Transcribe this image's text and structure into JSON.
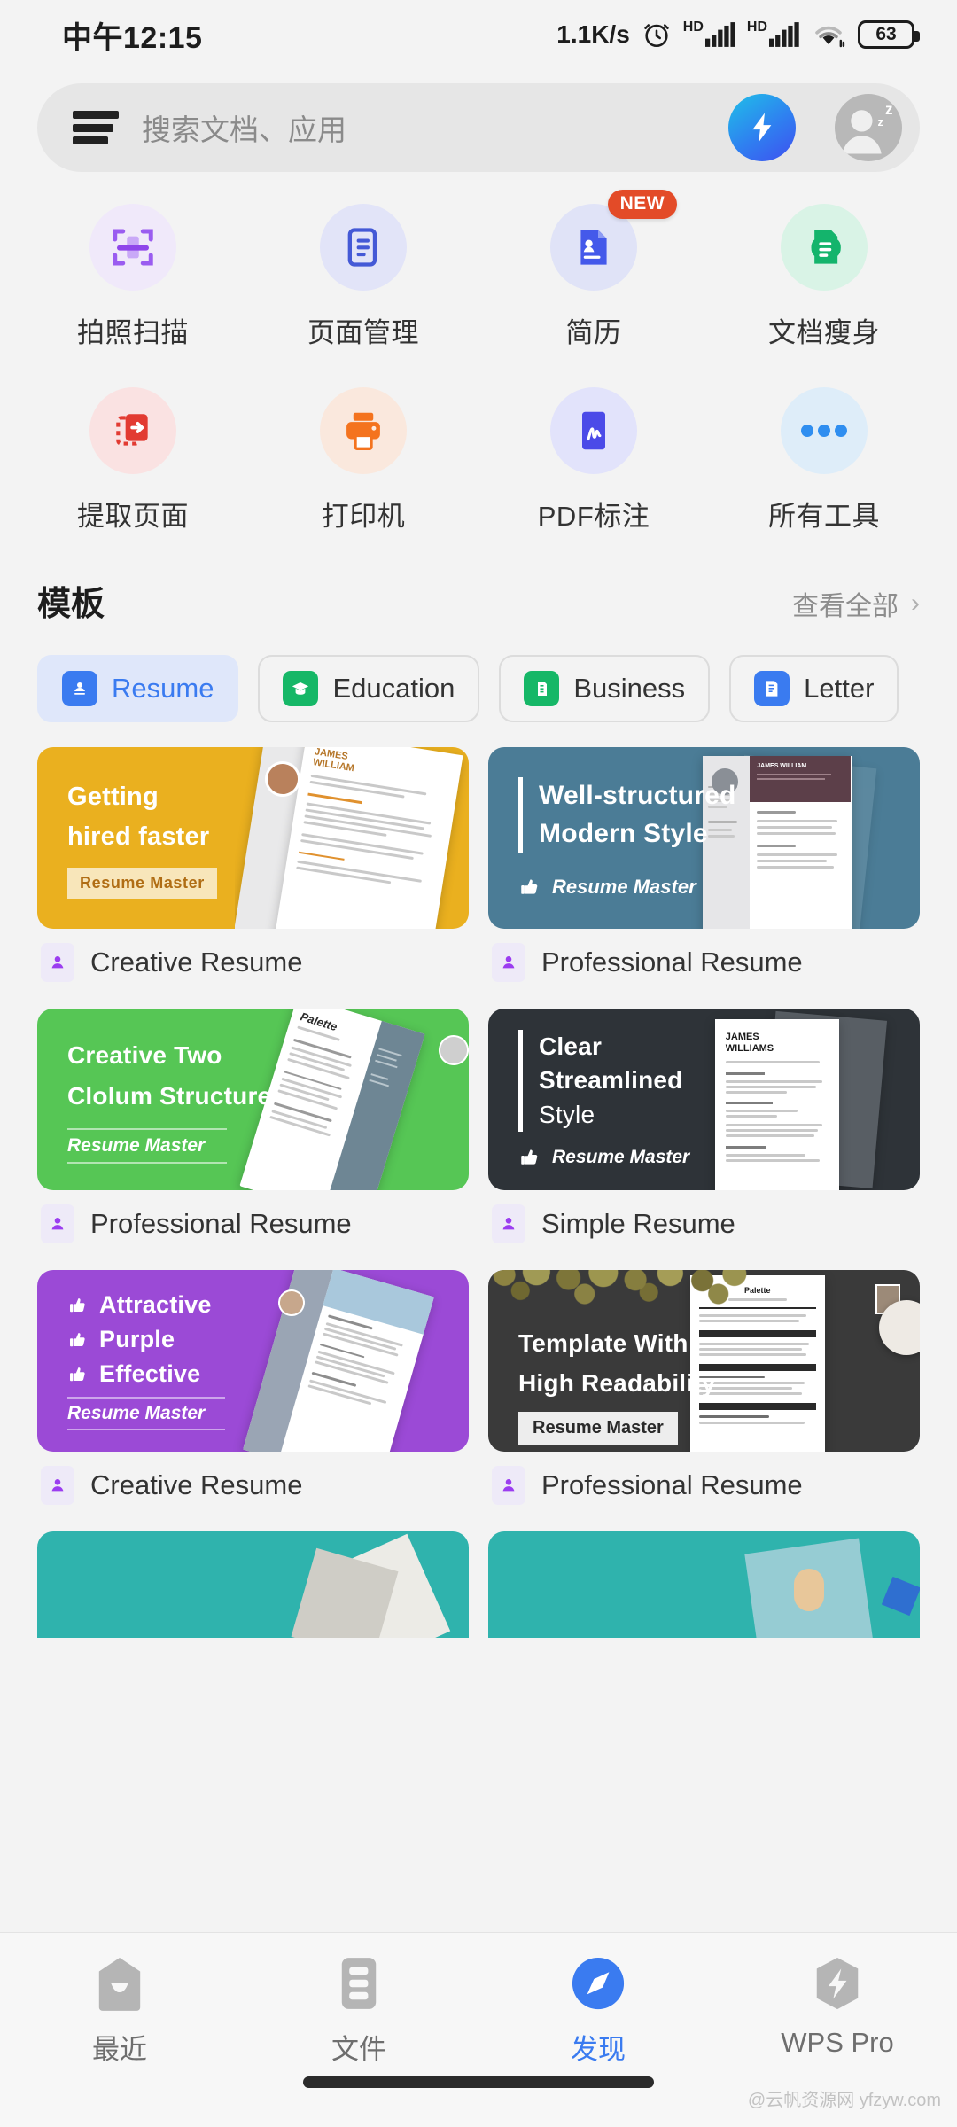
{
  "status_bar": {
    "time": "中午12:15",
    "network_speed": "1.1K/s",
    "alarm_icon": "alarm-clock-icon",
    "signal_1_label": "HD",
    "signal_2_label": "HD",
    "wifi_icon": "wifi-icon",
    "battery_level": "63"
  },
  "search": {
    "menu_icon": "hamburger-menu-icon",
    "placeholder": "搜索文档、应用",
    "bolt_icon": "lightning-bolt-icon",
    "avatar_icon": "user-avatar-sleep-icon"
  },
  "tools": [
    {
      "label": "拍照扫描",
      "icon": "scan-frame-icon",
      "bg": "#f0e9fa",
      "fg": "#9a5cf0",
      "badge": null
    },
    {
      "label": "页面管理",
      "icon": "page-manage-icon",
      "bg": "#e2e4f8",
      "fg": "#4459d6",
      "badge": null
    },
    {
      "label": "简历",
      "icon": "resume-document-icon",
      "bg": "#e0e3f7",
      "fg": "#4459ea",
      "badge": "NEW"
    },
    {
      "label": "文档瘦身",
      "icon": "document-compress-icon",
      "bg": "#d9f3e6",
      "fg": "#14b46c",
      "badge": null
    },
    {
      "label": "提取页面",
      "icon": "extract-page-icon",
      "bg": "#fae2e2",
      "fg": "#e23b32",
      "badge": null
    },
    {
      "label": "打印机",
      "icon": "printer-icon",
      "bg": "#fae8dd",
      "fg": "#f4731e",
      "badge": null
    },
    {
      "label": "PDF标注",
      "icon": "pdf-annotate-icon",
      "bg": "#e2e3fb",
      "fg": "#4b4ae8",
      "badge": null
    },
    {
      "label": "所有工具",
      "icon": "more-dots-icon",
      "bg": "#deedf9",
      "fg": "#2f8ef0",
      "badge": null
    }
  ],
  "templates": {
    "section_title": "模板",
    "view_all_label": "查看全部",
    "view_all_chevron": "chevron-right-icon",
    "tabs": [
      {
        "label": "Resume",
        "icon": "resume-person-icon",
        "icon_bg": "#3a7bf0",
        "active": true
      },
      {
        "label": "Education",
        "icon": "graduation-cap-icon",
        "icon_bg": "#16b767",
        "active": false
      },
      {
        "label": "Business",
        "icon": "office-building-icon",
        "icon_bg": "#16b767",
        "active": false
      },
      {
        "label": "Letter",
        "icon": "letter-doc-icon",
        "icon_bg": "#3a7bf0",
        "active": false
      }
    ],
    "cards": [
      {
        "headline": [
          "Getting",
          "hired faster"
        ],
        "badge_text": "Resume Master",
        "badge_style": "block",
        "bg": "#eab01f",
        "caption": "Creative Resume",
        "caption_icon": "person-card-icon"
      },
      {
        "headline": [
          "Well-structured",
          "Modern Style"
        ],
        "badge_text": "Resume Master",
        "badge_style": "thumb",
        "bg": "#4b7c96",
        "caption": "Professional Resume",
        "caption_icon": "person-card-icon"
      },
      {
        "headline": [
          "Creative Two",
          "Clolum Structure"
        ],
        "badge_text": "Resume Master",
        "badge_style": "rules",
        "bg": "#56c655",
        "caption": "Professional Resume",
        "caption_icon": "person-card-icon"
      },
      {
        "headline": [
          "Clear",
          "Streamlined",
          "Style"
        ],
        "badge_text": "Resume Master",
        "badge_style": "thumb",
        "bg": "#2e3338",
        "caption": "Simple Resume",
        "caption_icon": "person-card-icon"
      },
      {
        "headline": [
          "Attractive",
          "Purple",
          "Effective"
        ],
        "badge_text": "Resume Master",
        "badge_style": "rules",
        "bg": "#9b4ad6",
        "caption": "Creative Resume",
        "caption_icon": "person-card-icon"
      },
      {
        "headline": [
          "Template With",
          "High Readability"
        ],
        "badge_text": "Resume Master",
        "badge_style": "block-dark",
        "bg": "#3a3a3a",
        "caption": "Professional Resume",
        "caption_icon": "person-card-icon"
      }
    ],
    "partial_row_color": "#2fb3ad"
  },
  "bottom_nav": [
    {
      "label": "最近",
      "icon": "recent-icon",
      "active": false
    },
    {
      "label": "文件",
      "icon": "files-icon",
      "active": false
    },
    {
      "label": "发现",
      "icon": "compass-icon",
      "active": true
    },
    {
      "label": "WPS Pro",
      "icon": "wps-pro-icon",
      "active": false
    }
  ],
  "watermark": "@云帆资源网 yfzyw.com"
}
